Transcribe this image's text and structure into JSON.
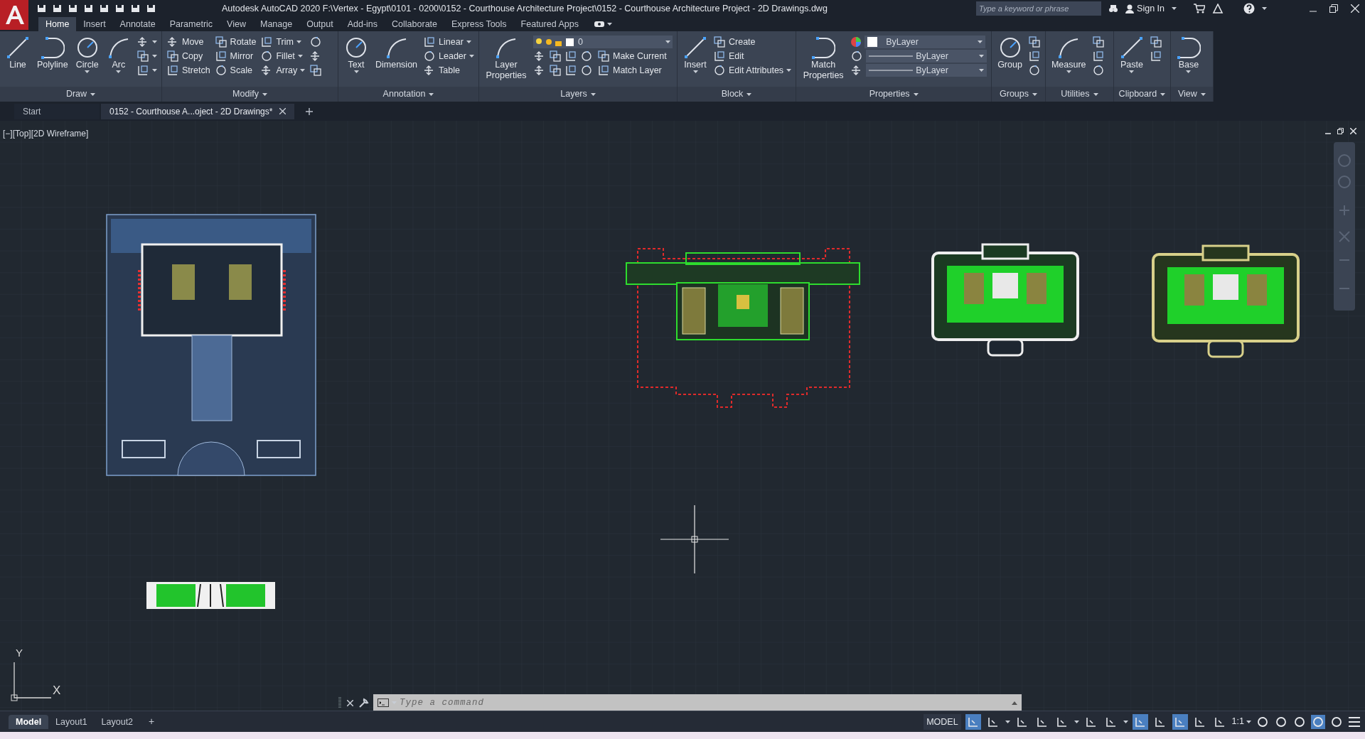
{
  "app": {
    "title": "Autodesk AutoCAD 2020   F:\\Vertex - Egypt\\0101 - 0200\\0152 - Courthouse Architecture Project\\0152 - Courthouse Architecture Project - 2D Drawings.dwg",
    "search": {
      "placeholder": "Type a keyword or phrase"
    },
    "sign_in": "Sign In"
  },
  "menu_tabs": [
    {
      "label": "Home",
      "selected": true
    },
    {
      "label": "Insert",
      "selected": false
    },
    {
      "label": "Annotate",
      "selected": false
    },
    {
      "label": "Parametric",
      "selected": false
    },
    {
      "label": "View",
      "selected": false
    },
    {
      "label": "Manage",
      "selected": false
    },
    {
      "label": "Output",
      "selected": false
    },
    {
      "label": "Add-ins",
      "selected": false
    },
    {
      "label": "Collaborate",
      "selected": false
    },
    {
      "label": "Express Tools",
      "selected": false
    },
    {
      "label": "Featured Apps",
      "selected": false
    }
  ],
  "ribbon": [
    {
      "title": "Draw",
      "items": [
        {
          "kind": "large",
          "label": "Line",
          "caret": false
        },
        {
          "kind": "large",
          "label": "Polyline",
          "caret": false
        },
        {
          "kind": "large",
          "label": "Circle",
          "caret": true
        },
        {
          "kind": "large",
          "label": "Arc",
          "caret": true
        },
        {
          "kind": "column",
          "tools": [
            {
              "caret": true
            },
            {
              "caret": true
            },
            {
              "caret": true
            }
          ]
        }
      ]
    },
    {
      "title": "Modify",
      "items": [
        {
          "kind": "column",
          "tools": [
            {
              "label": "Move",
              "caret": false
            },
            {
              "label": "Copy",
              "caret": false
            },
            {
              "label": "Stretch",
              "caret": false
            }
          ]
        },
        {
          "kind": "column",
          "tools": [
            {
              "label": "Rotate",
              "caret": false
            },
            {
              "label": "Mirror",
              "caret": false
            },
            {
              "label": "Scale",
              "caret": false
            }
          ]
        },
        {
          "kind": "column",
          "tools": [
            {
              "label": "Trim",
              "caret": true
            },
            {
              "label": "Fillet",
              "caret": true
            },
            {
              "label": "Array",
              "caret": true
            }
          ]
        },
        {
          "kind": "column",
          "tools": [
            {
              "caret": false
            },
            {
              "caret": false
            },
            {
              "caret": false
            }
          ]
        }
      ]
    },
    {
      "title": "Annotation",
      "items": [
        {
          "kind": "large",
          "label": "Text",
          "caret": true
        },
        {
          "kind": "large",
          "label": "Dimension",
          "caret": false
        },
        {
          "kind": "column",
          "tools": [
            {
              "label": "Linear",
              "caret": true
            },
            {
              "label": "Leader",
              "caret": true
            },
            {
              "label": "Table",
              "caret": false
            }
          ]
        }
      ]
    },
    {
      "title": "Layers",
      "items": [
        {
          "kind": "large",
          "label": "Layer Properties",
          "caret": false
        },
        {
          "kind": "layers",
          "dropdown": "0",
          "tools": [
            {
              "label": "Make Current"
            },
            {
              "label": "Match Layer"
            }
          ]
        }
      ]
    },
    {
      "title": "Block",
      "items": [
        {
          "kind": "large",
          "label": "Insert",
          "caret": true
        },
        {
          "kind": "column",
          "tools": [
            {
              "label": "Create",
              "caret": false
            },
            {
              "label": "Edit",
              "caret": false
            },
            {
              "label": "Edit Attributes",
              "caret": true
            }
          ]
        }
      ]
    },
    {
      "title": "Properties",
      "items": [
        {
          "kind": "large",
          "label": "Match Properties",
          "caret": false
        },
        {
          "kind": "properties",
          "dropdowns": [
            {
              "kind": "color",
              "value": "ByLayer"
            },
            {
              "kind": "line",
              "value": "ByLayer"
            },
            {
              "kind": "line",
              "value": "ByLayer"
            }
          ]
        }
      ]
    },
    {
      "title": "Groups",
      "items": [
        {
          "kind": "large",
          "label": "Group",
          "caret": false
        },
        {
          "kind": "column",
          "tools": [
            {
              "caret": false
            },
            {
              "caret": false
            },
            {
              "caret": false
            }
          ]
        }
      ]
    },
    {
      "title": "Utilities",
      "items": [
        {
          "kind": "large",
          "label": "Measure",
          "caret": true
        },
        {
          "kind": "column",
          "tools": [
            {
              "caret": false
            },
            {
              "caret": false
            },
            {
              "caret": false
            }
          ]
        }
      ]
    },
    {
      "title": "Clipboard",
      "items": [
        {
          "kind": "large",
          "label": "Paste",
          "caret": true
        },
        {
          "kind": "column",
          "tools": [
            {
              "caret": false
            },
            {
              "caret": false
            }
          ]
        }
      ]
    },
    {
      "title": "View",
      "items": [
        {
          "kind": "large",
          "label": "Base",
          "caret": true
        }
      ]
    }
  ],
  "doc_tabs": [
    {
      "label": "Start",
      "selected": false,
      "closable": false
    },
    {
      "label": "0152 - Courthouse A...oject - 2D Drawings*",
      "selected": true,
      "closable": true
    }
  ],
  "viewport": {
    "label": "[−][Top][2D Wireframe]",
    "axis_y": "Y",
    "axis_x": "X"
  },
  "command_line": {
    "placeholder": "Type a command"
  },
  "layout_tabs": [
    {
      "label": "Model",
      "selected": true
    },
    {
      "label": "Layout1",
      "selected": false
    },
    {
      "label": "Layout2",
      "selected": false
    }
  ],
  "add_layout": "+",
  "status_bar": {
    "space": "MODEL",
    "scale": "1:1"
  }
}
